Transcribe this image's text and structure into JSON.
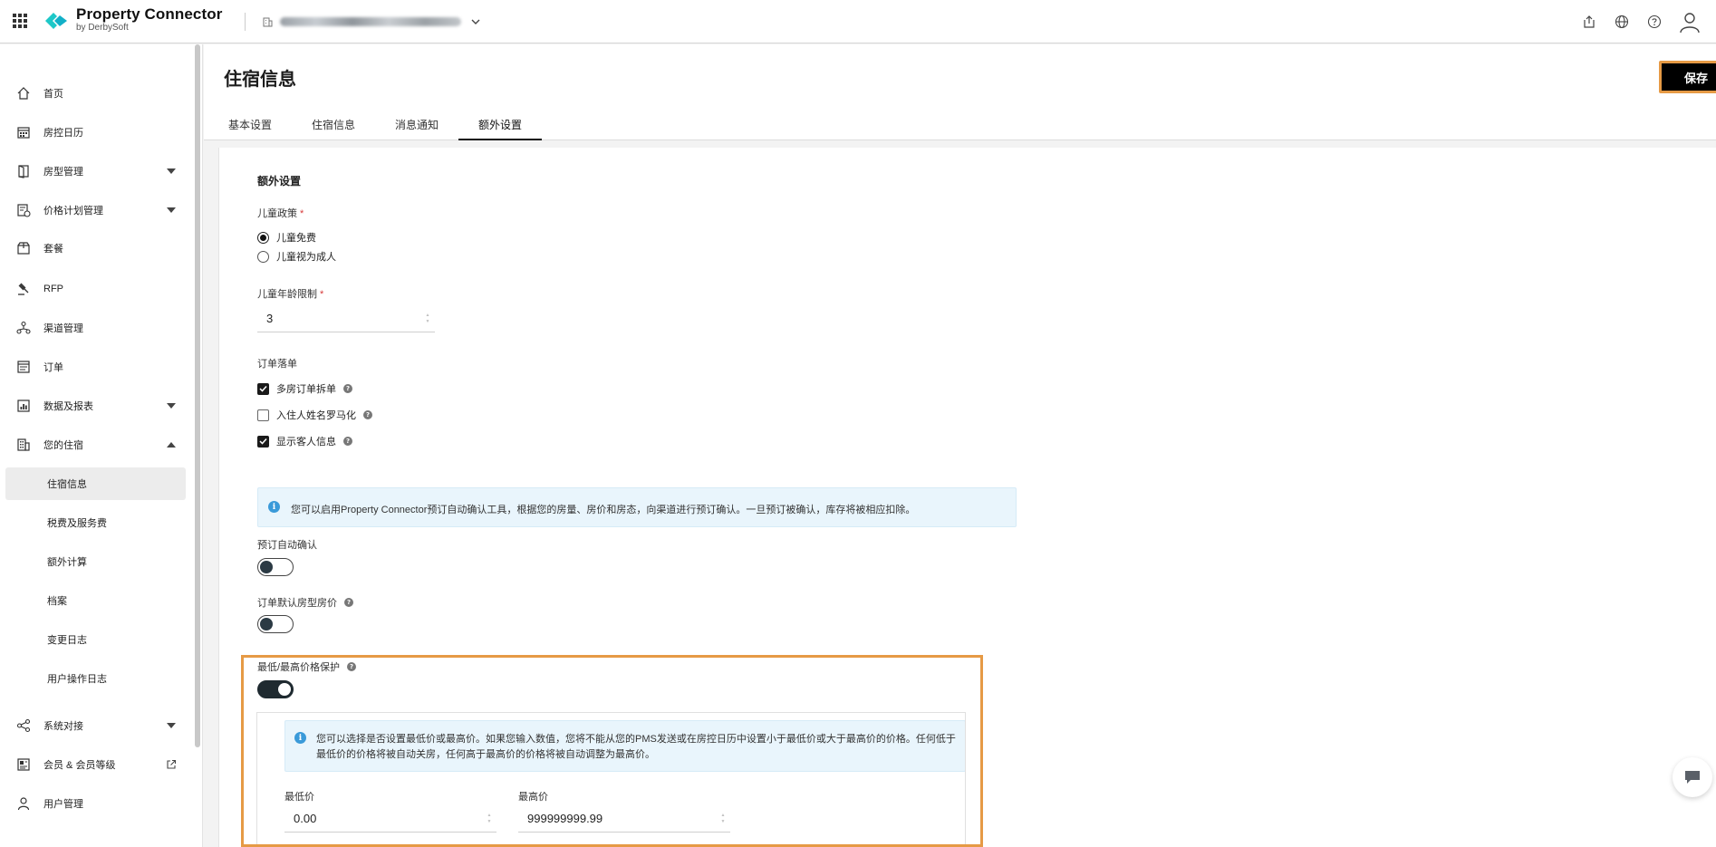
{
  "topbar": {
    "brand_name": "Property Connector",
    "brand_sub": "by DerbySoft",
    "icons": [
      "apps-grid-icon",
      "building-icon",
      "chevron-down-icon",
      "export-icon",
      "globe-icon",
      "help-circle-icon",
      "user-avatar-icon"
    ]
  },
  "sidebar": {
    "items": [
      {
        "label": "首页",
        "icon": "home-icon"
      },
      {
        "label": "房控日历",
        "icon": "calendar-icon"
      },
      {
        "label": "房型管理",
        "icon": "door-icon",
        "expandable": true
      },
      {
        "label": "价格计划管理",
        "icon": "price-plan-icon",
        "expandable": true
      },
      {
        "label": "套餐",
        "icon": "package-icon"
      },
      {
        "label": "RFP",
        "icon": "gavel-icon"
      },
      {
        "label": "渠道管理",
        "icon": "channel-icon"
      },
      {
        "label": "订单",
        "icon": "order-icon"
      },
      {
        "label": "数据及报表",
        "icon": "chart-icon",
        "expandable": true
      },
      {
        "label": "您的住宿",
        "icon": "building-icon",
        "expanded": true
      },
      {
        "label": "系统对接",
        "icon": "share-icon",
        "expandable": true
      },
      {
        "label": "会员 & 会员等级",
        "icon": "member-card-icon",
        "external": true
      },
      {
        "label": "用户管理",
        "icon": "user-icon"
      }
    ],
    "sub_items": [
      {
        "label": "住宿信息",
        "active": true
      },
      {
        "label": "税费及服务费"
      },
      {
        "label": "额外计算"
      },
      {
        "label": "档案"
      },
      {
        "label": "变更日志"
      },
      {
        "label": "用户操作日志"
      }
    ]
  },
  "header": {
    "title": "住宿信息",
    "save_label": "保存",
    "tabs": [
      {
        "label": "基本设置"
      },
      {
        "label": "住宿信息"
      },
      {
        "label": "消息通知"
      },
      {
        "label": "额外设置",
        "active": true
      }
    ]
  },
  "form": {
    "section_title": "额外设置",
    "child_policy": {
      "label": "儿童政策",
      "options": [
        {
          "label": "儿童免费",
          "selected": true
        },
        {
          "label": "儿童视为成人",
          "selected": false
        }
      ]
    },
    "child_age": {
      "label": "儿童年龄限制",
      "value": "3"
    },
    "order_split": {
      "label": "订单落单",
      "options": [
        {
          "label": "多房订单拆单",
          "checked": true
        },
        {
          "label": "入住人姓名罗马化",
          "checked": false
        },
        {
          "label": "显示客人信息",
          "checked": true
        }
      ]
    },
    "auto_confirm_info": "您可以启用Property Connector预订自动确认工具，根据您的房量、房价和房态，向渠道进行预订确认。一旦预订被确认，库存将被相应扣除。",
    "auto_confirm": {
      "label": "预订自动确认",
      "on": false
    },
    "default_rate": {
      "label": "订单默认房型房价",
      "on": false
    },
    "price_protect": {
      "label": "最低/最高价格保护",
      "on": true,
      "info_line1": "您可以选择是否设置最低价或最高价。如果您输入数值，您将不能从您的PMS发送或在房控日历中设置小于最低价或大于最高价的价格。任何低于",
      "info_line2": "最低价的价格将被自动关房，任何高于最高价的价格将被自动调整为最高价。",
      "min_label": "最低价",
      "min_value": "0.00",
      "max_label": "最高价",
      "max_value": "999999999.99"
    }
  },
  "colors": {
    "accent_highlight": "#e69a45",
    "info_bg": "#e9f5fc",
    "info_icon": "#3a9ad9",
    "required": "#d73a3a",
    "logo": "#1ec8c8"
  }
}
